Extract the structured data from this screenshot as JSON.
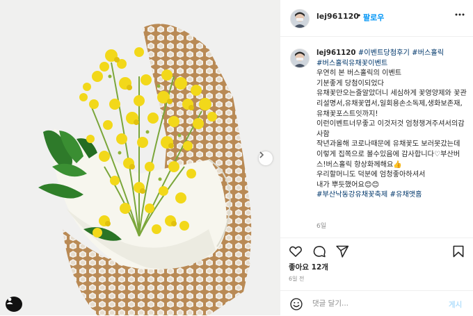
{
  "post": {
    "username": "lej961120",
    "separator": "•",
    "follow_label": "팔로우"
  },
  "caption": {
    "username": "lej961120",
    "hashtags_first": "#이벤트당첨후기 #버스홀릭",
    "hashtags_second": "#버스홀릭유채꽃이벤트",
    "body": "우연히 본 버스홀릭의 이벤트\n기분좋게 당첨이되었다\n유채꽃만오는줄알았더니 세심하게 꽃영양제와 꽃관리설명서,유채꽃엽서,일회용손소독제,생화보존재,유채꽃포스트잇까지!\n이런이벤트너무좋고 이것저것 엄청챙겨주셔서의감사함\n작년과올해 코로나때문에 유채꽃도 보러못갔는데 이렇게 집쪽으로 볼수있음에 감사합니다♡부산버스!버스홀릭 항상화께해요👍\n우리할머니도 덕분에 엄청좋아하셔서\n내가 뿌듯했어요😊😊",
    "hashtags_end": "#부산낙동강유채꽃축제 #유채앳홈",
    "time_ago": "6일"
  },
  "stats": {
    "likes_label": "좋아요 12개",
    "date_label": "6일 전"
  },
  "comment": {
    "placeholder": "댓글 달기...",
    "post_label": "게시"
  },
  "icons": {
    "more": "more-horizontal-icon",
    "like": "heart-icon",
    "comment": "comment-bubble-icon",
    "share": "paper-plane-icon",
    "save": "bookmark-icon",
    "emoji": "smiley-icon",
    "next": "chevron-right-icon",
    "tagged": "user-tag-icon"
  },
  "colors": {
    "link_blue": "#0095f6",
    "hashtag": "#00376b",
    "muted": "#8e8e8e",
    "post_disabled": "#b2dffc"
  }
}
